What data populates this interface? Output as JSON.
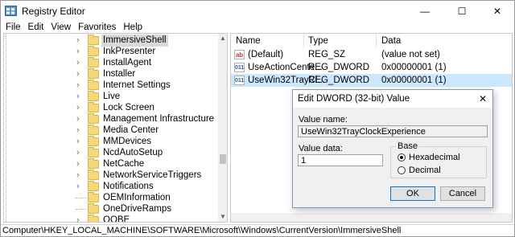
{
  "window": {
    "title": "Registry Editor",
    "minimize": "—",
    "maximize": "☐",
    "close": "✕"
  },
  "menu": [
    "File",
    "Edit",
    "View",
    "Favorites",
    "Help"
  ],
  "tree": {
    "items": [
      {
        "label": "ImmersiveShell",
        "expandable": true,
        "selected": true
      },
      {
        "label": "InkPresenter",
        "expandable": true
      },
      {
        "label": "InstallAgent",
        "expandable": true
      },
      {
        "label": "Installer",
        "expandable": true
      },
      {
        "label": "Internet Settings",
        "expandable": true
      },
      {
        "label": "Live",
        "expandable": true
      },
      {
        "label": "Lock Screen",
        "expandable": true
      },
      {
        "label": "Management Infrastructure",
        "expandable": true
      },
      {
        "label": "Media Center",
        "expandable": true
      },
      {
        "label": "MMDevices",
        "expandable": true
      },
      {
        "label": "NcdAutoSetup",
        "expandable": true
      },
      {
        "label": "NetCache",
        "expandable": true
      },
      {
        "label": "NetworkServiceTriggers",
        "expandable": true
      },
      {
        "label": "Notifications",
        "expandable": true
      },
      {
        "label": "OEMInformation",
        "expandable": false
      },
      {
        "label": "OneDriveRamps",
        "expandable": false
      },
      {
        "label": "OOBE",
        "expandable": true
      }
    ]
  },
  "values": {
    "columns": {
      "name": "Name",
      "type": "Type",
      "data": "Data"
    },
    "rows": [
      {
        "icon": "ab",
        "name": "(Default)",
        "type": "REG_SZ",
        "data": "(value not set)",
        "selected": false
      },
      {
        "icon": "011",
        "name": "UseActionCente...",
        "type": "REG_DWORD",
        "data": "0x00000001 (1)",
        "selected": false
      },
      {
        "icon": "011",
        "name": "UseWin32TrayCl...",
        "type": "REG_DWORD",
        "data": "0x00000001 (1)",
        "selected": true
      }
    ]
  },
  "status": {
    "path": "Computer\\HKEY_LOCAL_MACHINE\\SOFTWARE\\Microsoft\\Windows\\CurrentVersion\\ImmersiveShell"
  },
  "dialog": {
    "title": "Edit DWORD (32-bit) Value",
    "close": "✕",
    "value_name_label": "Value name:",
    "value_name": "UseWin32TrayClockExperience",
    "value_data_label": "Value data:",
    "value_data": "1",
    "base_label": "Base",
    "base_options": [
      {
        "label": "Hexadecimal",
        "selected": true
      },
      {
        "label": "Decimal",
        "selected": false
      }
    ],
    "ok": "OK",
    "cancel": "Cancel"
  },
  "colors": {
    "selection": "#cce8ff",
    "folder": "#f6d878",
    "dialog_bg": "#f0f0f0"
  }
}
